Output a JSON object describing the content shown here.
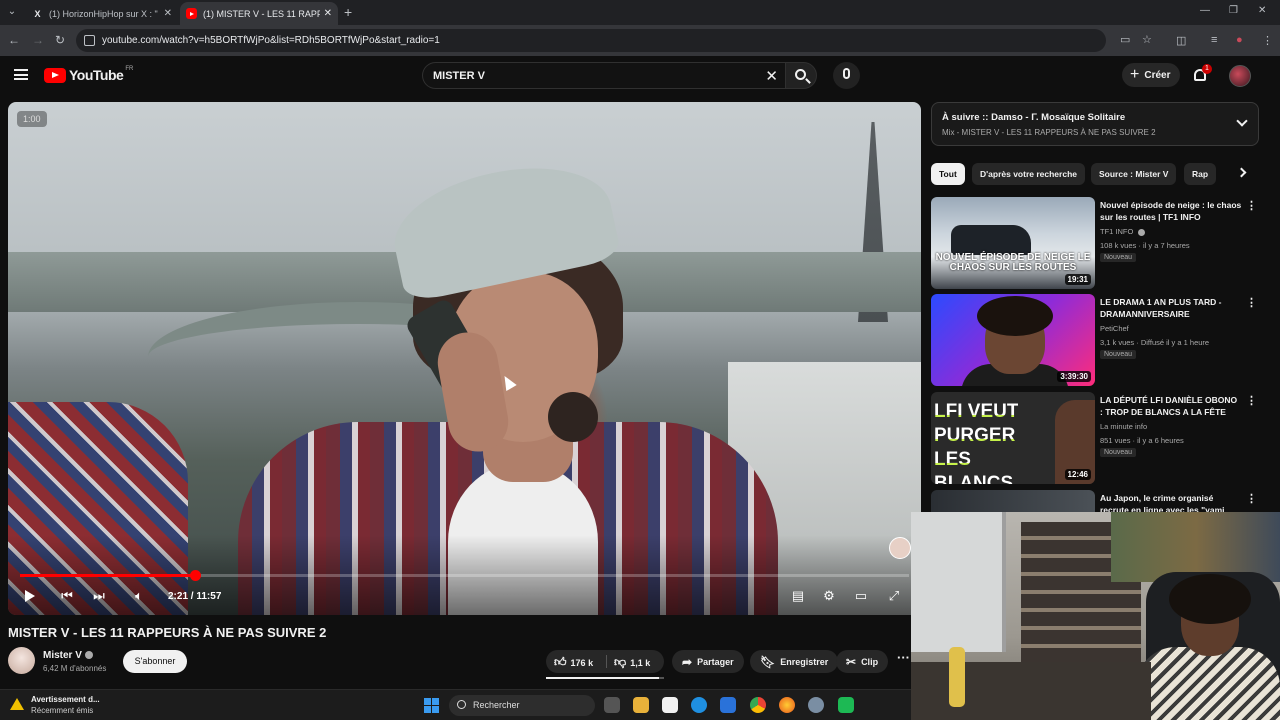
{
  "browser": {
    "tabs": [
      {
        "label": "(1) HorizonHipHop sur X : \"",
        "favicon": "x-icon"
      },
      {
        "label": "(1) MISTER V - LES 11 RAPPEUR",
        "favicon": "youtube-icon",
        "active": true
      }
    ],
    "url": "youtube.com/watch?v=h5BORTfWjPo&list=RDh5BORTfWjPo&start_radio=1"
  },
  "youtube": {
    "logo_text": "YouTube",
    "region": "FR",
    "search_value": "MISTER V",
    "create_label": "Créer",
    "notification_count": "1"
  },
  "player": {
    "duration_hint": "1:00",
    "time_display": "2:21 / 11:57",
    "progress_fraction": 0.197
  },
  "video": {
    "title": "MISTER V - LES 11 RAPPEURS À NE PAS SUIVRE 2",
    "channel": "Mister V",
    "subscribers": "6,42 M d'abonnés",
    "subscribe_label": "S'abonner",
    "likes": "176 k",
    "dislikes": "1,1 k",
    "like_ratio": 0.96,
    "share_label": "Partager",
    "save_label": "Enregistrer",
    "clip_label": "Clip",
    "more_label": "···"
  },
  "queue": {
    "line1": "À suivre :: Damso - Γ. Mosaïque Solitaire",
    "line2": "Mix - MISTER V - LES 11 RAPPEURS À NE PAS SUIVRE 2"
  },
  "chips": [
    "Tout",
    "D'après votre recherche",
    "Source : Mister V",
    "Rap"
  ],
  "recommendations": [
    {
      "title": "Nouvel épisode de neige : le chaos sur les routes | TF1 INFO",
      "channel": "TF1 INFO",
      "meta": "108 k vues · il y a 7 heures",
      "badge": "Nouveau",
      "duration": "19:31",
      "thumb_text": "NOUVEL ÉPISODE DE NEIGE LE CHAOS SUR LES ROUTES"
    },
    {
      "title": "LE DRAMA 1 AN PLUS TARD - DRAMANNIVERSAIRE",
      "channel": "PetiChef",
      "meta": "3,1 k vues · Diffusé il y a 1 heure",
      "badge": "Nouveau",
      "duration": "3:39:30",
      "thumb_text": ""
    },
    {
      "title": "LA DÉPUTÉ LFI DANIÈLE OBONO : TROP DE BLANCS A LA FÊTE DE...",
      "channel": "La minute info",
      "meta": "851 vues · il y a 6 heures",
      "badge": "Nouveau",
      "duration": "12:46",
      "thumb_text": "LFI VEUT PURGER LES BLANCS"
    },
    {
      "title": "Au Japon, le crime organisé recrute en ligne avec les \"yami",
      "channel": "",
      "meta": "",
      "badge": "",
      "duration": "",
      "thumb_text": ""
    }
  ],
  "taskbar": {
    "warning_title": "Avertissement d...",
    "warning_sub": "Récemment émis",
    "search_label": "Rechercher"
  }
}
